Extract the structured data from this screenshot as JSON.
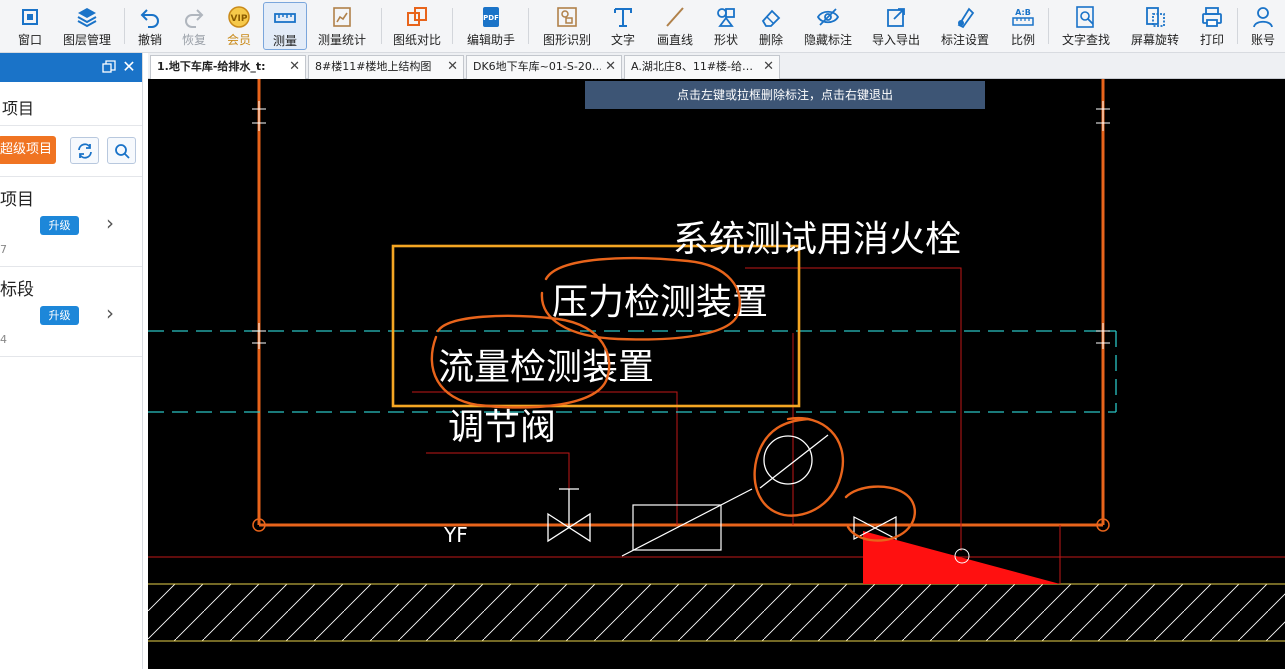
{
  "toolbar": {
    "items": [
      {
        "label": "窗口",
        "icon": "window-icon"
      },
      {
        "label": "图层管理",
        "icon": "layers-icon"
      },
      {
        "label": "撤销",
        "icon": "undo-icon"
      },
      {
        "label": "恢复",
        "icon": "redo-icon"
      },
      {
        "label": "会员",
        "icon": "vip-icon"
      },
      {
        "label": "测量",
        "icon": "measure-icon"
      },
      {
        "label": "测量统计",
        "icon": "measure-stats-icon"
      },
      {
        "label": "图纸对比",
        "icon": "compare-icon"
      },
      {
        "label": "编辑助手",
        "icon": "edit-assistant-icon"
      },
      {
        "label": "图形识别",
        "icon": "shape-recognize-icon"
      },
      {
        "label": "文字",
        "icon": "text-icon"
      },
      {
        "label": "画直线",
        "icon": "line-icon"
      },
      {
        "label": "形状",
        "icon": "shape-icon"
      },
      {
        "label": "删除",
        "icon": "eraser-icon"
      },
      {
        "label": "隐藏标注",
        "icon": "eye-hide-icon"
      },
      {
        "label": "导入导出",
        "icon": "import-export-icon"
      },
      {
        "label": "标注设置",
        "icon": "annotation-settings-icon"
      },
      {
        "label": "比例",
        "icon": "scale-icon"
      },
      {
        "label": "文字查找",
        "icon": "text-search-icon"
      },
      {
        "label": "屏幕旋转",
        "icon": "rotate-screen-icon"
      },
      {
        "label": "打印",
        "icon": "print-icon"
      },
      {
        "label": "账号",
        "icon": "account-icon"
      }
    ]
  },
  "left_panel": {
    "title": "项目",
    "super_button": "超级项目",
    "cards": [
      {
        "name": "项目",
        "upgrade": "升级",
        "sub": "7"
      },
      {
        "name": "标段",
        "upgrade": "升级",
        "sub": "4"
      }
    ]
  },
  "tabs": [
    {
      "label": "1.地下车库-给排水_t:",
      "active": true
    },
    {
      "label": "8#楼11#楼地上结构图",
      "active": false
    },
    {
      "label": "DK6地下车库~01-S-20…",
      "active": false
    },
    {
      "label": "A.湖北庄8、11#楼-给…",
      "active": false
    }
  ],
  "canvas": {
    "hint": "点击左键或拉框删除标注，点击右键退出",
    "labels": {
      "fire_test": "系统测试用消火栓",
      "pressure": "压力检测装置",
      "flow": "流量检测装置",
      "regulator": "调节阀",
      "yf": "YF"
    }
  },
  "colors": {
    "accent_blue": "#1a73c8",
    "orange": "#f07422",
    "canvas_bg": "#000000",
    "pipe_orange": "#e8641b",
    "highlight_yellow": "#f5a623",
    "cyan_dash": "#2ac4c4"
  }
}
